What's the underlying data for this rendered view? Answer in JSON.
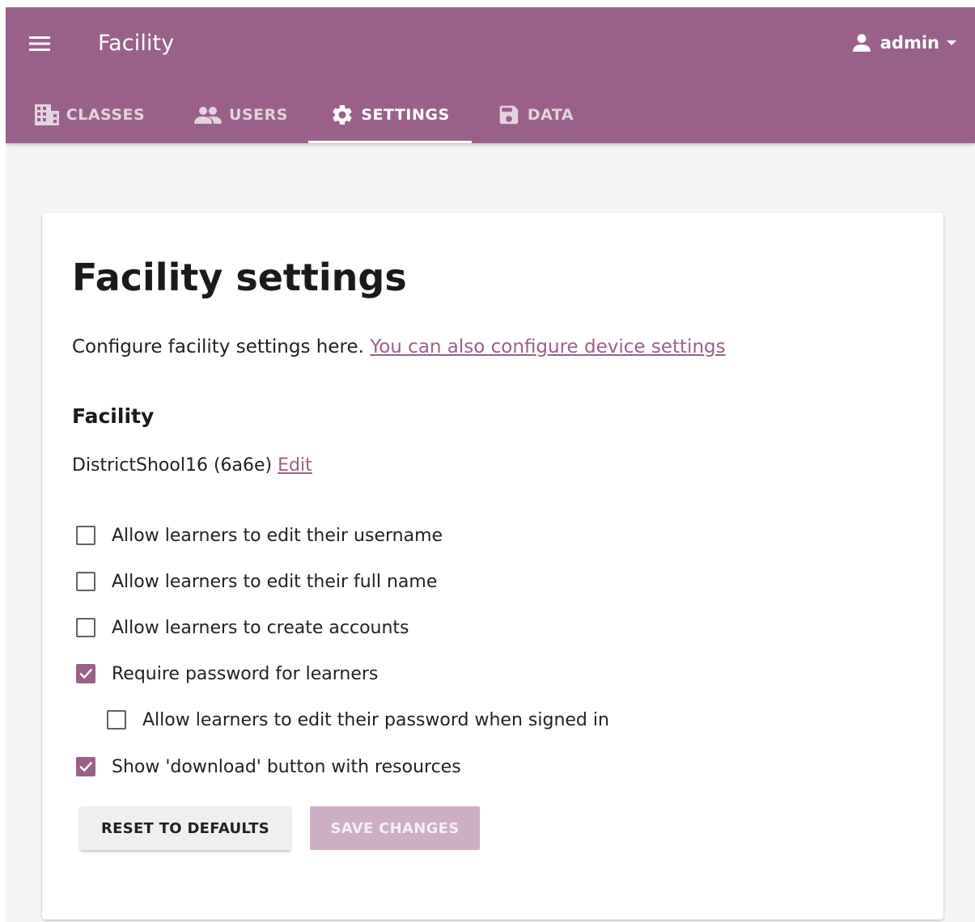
{
  "header": {
    "title": "Facility",
    "user_name": "admin",
    "icons": {
      "menu": "hamburger-menu-icon",
      "user": "person-icon",
      "dropdown": "caret-down-icon"
    }
  },
  "tabs": [
    {
      "label": "CLASSES",
      "icon": "classes-building-icon",
      "active": false
    },
    {
      "label": "USERS",
      "icon": "people-icon",
      "active": false
    },
    {
      "label": "SETTINGS",
      "icon": "gear-icon",
      "active": true
    },
    {
      "label": "DATA",
      "icon": "floppy-disk-icon",
      "active": false
    }
  ],
  "main": {
    "title": "Facility settings",
    "intro_text": "Configure facility settings here.",
    "device_settings_link": "You can also configure device settings",
    "section_heading": "Facility",
    "facility_name": "DistrictShool16 (6a6e)",
    "edit_link": "Edit"
  },
  "settings": [
    {
      "label": "Allow learners to edit their username",
      "checked": false,
      "indent": false
    },
    {
      "label": "Allow learners to edit their full name",
      "checked": false,
      "indent": false
    },
    {
      "label": "Allow learners to create accounts",
      "checked": false,
      "indent": false
    },
    {
      "label": "Require password for learners",
      "checked": true,
      "indent": false
    },
    {
      "label": "Allow learners to edit their password when signed in",
      "checked": false,
      "indent": true
    },
    {
      "label": "Show 'download' button with resources",
      "checked": true,
      "indent": false
    }
  ],
  "buttons": {
    "reset": "RESET TO DEFAULTS",
    "save": "SAVE CHANGES",
    "save_disabled": true
  },
  "colors": {
    "brand": "#996189",
    "brand_disabled": "#cdaec5",
    "background": "#f5f5f5"
  }
}
